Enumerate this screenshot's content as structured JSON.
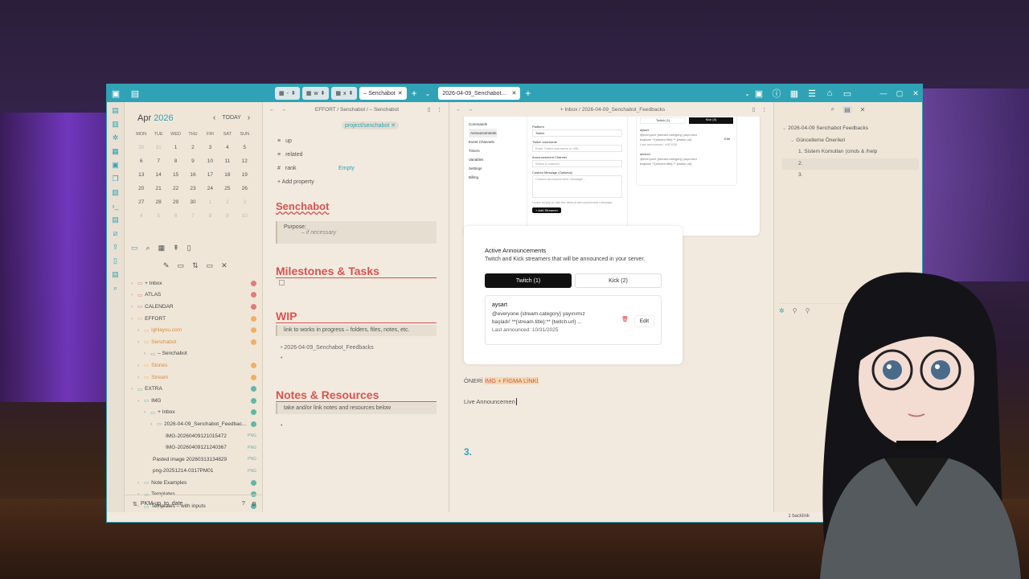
{
  "window": {
    "tabs": [
      {
        "label": "-",
        "pinned": true
      },
      {
        "label": "w",
        "pinned": true
      },
      {
        "label": "x",
        "pinned": true
      },
      {
        "label": "– Senchabot",
        "active": true
      },
      {
        "label": "2026-04-09_Senchabot_Feed...",
        "active": true
      }
    ]
  },
  "calendar": {
    "month": "Apr",
    "year": "2026",
    "today_label": "TODAY",
    "dow": [
      "MON",
      "TUE",
      "WED",
      "THU",
      "FRI",
      "SAT",
      "SUN"
    ],
    "days": [
      [
        "30",
        "31",
        "1",
        "2",
        "3",
        "4",
        "5"
      ],
      [
        "6",
        "7",
        "8",
        "9",
        "10",
        "11",
        "12"
      ],
      [
        "13",
        "14",
        "15",
        "16",
        "17",
        "18",
        "19"
      ],
      [
        "20",
        "21",
        "22",
        "23",
        "24",
        "25",
        "26"
      ],
      [
        "27",
        "28",
        "29",
        "30",
        "1",
        "2",
        "3"
      ],
      [
        "4",
        "5",
        "6",
        "7",
        "8",
        "9",
        "10"
      ]
    ]
  },
  "tree": [
    {
      "label": "+ Inbox",
      "indent": 1,
      "color": "#e07b7b"
    },
    {
      "label": "ATLAS",
      "indent": 1,
      "color": "#e07b7b"
    },
    {
      "label": "CALENDAR",
      "indent": 1,
      "color": "#e07b7b"
    },
    {
      "label": "EFFORT",
      "indent": 1,
      "color": "#f0b060"
    },
    {
      "label": "ighlaysu.com",
      "indent": 2,
      "color": "#f0b060"
    },
    {
      "label": "Senchabot",
      "indent": 2,
      "color": "#f0b060"
    },
    {
      "label": "– Senchabot",
      "indent": 3,
      "color": ""
    },
    {
      "label": "Stories",
      "indent": 2,
      "color": "#f0b060"
    },
    {
      "label": "Stream",
      "indent": 2,
      "color": "#f0b060"
    },
    {
      "label": "EXTRA",
      "indent": 1,
      "color": "#5fb8a8"
    },
    {
      "label": "IMG",
      "indent": 2,
      "color": "#5fb8a8"
    },
    {
      "label": "+ Inbox",
      "indent": 3,
      "color": "#5fb8a8"
    },
    {
      "label": "2026-04-09_Senchabot_Feedbac...",
      "indent": 4,
      "color": "#5fb8a8"
    },
    {
      "label": "IMG-20260409121015472",
      "indent": 5,
      "tag": "PNG"
    },
    {
      "label": "IMG-20260409121240367",
      "indent": 5,
      "tag": "PNG"
    },
    {
      "label": "Pasted image 20260313134829",
      "indent": 3,
      "tag": "PNG"
    },
    {
      "label": "png-20251214-0317PM01",
      "indent": 3,
      "tag": "PNG"
    },
    {
      "label": "Note Examples",
      "indent": 2,
      "color": "#5fb8a8"
    },
    {
      "label": "Templates",
      "indent": 2,
      "color": "#5fb8a8"
    },
    {
      "label": "Templates – with inputs",
      "indent": 2,
      "color": "#5fb8a8"
    }
  ],
  "sidebar_footer": {
    "vault": "PKM-up_to_date"
  },
  "pane1": {
    "breadcrumb": "EFFORT / Senchabot / – Senchabot",
    "tag": "project/senchabot",
    "props": [
      {
        "icon": "≡",
        "key": "up",
        "value": ""
      },
      {
        "icon": "≡",
        "key": "related",
        "value": ""
      },
      {
        "icon": "#",
        "key": "rank",
        "value": "Empty"
      }
    ],
    "add_property": "+ Add property",
    "title": "Senchabot",
    "purpose_label": "Purpose:",
    "purpose_hint": "– if necessary",
    "h_milestones": "Milestones & Tasks",
    "h_wip": "WIP",
    "wip_hint": "link to works in progress – folders, files, notes, etc.",
    "wip_link": "2026-04-09_Senchabot_Feedbacks",
    "h_notes": "Notes & Resources",
    "notes_hint": "take and/or link notes and resources below"
  },
  "pane2": {
    "breadcrumb": "+ Inbox / 2026-04-09_Senchabot_Feedbacks",
    "shot1": {
      "nav": [
        "Commands",
        "Announcements",
        "Event Channels",
        "Timers",
        "Variables",
        "Settings",
        "Billing"
      ],
      "platform_label": "Platform",
      "platform_value": "Twitch",
      "username_label": "Twitch Username",
      "username_placeholder": "Enter Twitch username or URL",
      "channel_label": "Announcement Channel",
      "channel_placeholder": "Select a channel",
      "msg_label": "Custom Message (Optional)",
      "msg_placeholder": "Custom announcement message...",
      "hint": "Leave empty to use the default announcement message",
      "add_btn": "+ Add Streamer",
      "tab_twitch": "Twitch (1)",
      "tab_kick": "Kick (0)",
      "entry1_name": "aysart",
      "entry1_text": "@everyone {stream.category} yayınımız başladı! **{stream.title}:** {twitch.url}",
      "entry1_date": "Last announced: 4/9/2026",
      "entry2_name": "senior1",
      "entry2_text": "@everyone {stream.category} yayınımız başladı! **{stream.title}:** {twitch.url}",
      "edit_label": "Edit"
    },
    "card": {
      "title": "Active Announcements",
      "subtitle": "Twitch and Kick streamers that will be announced in your server.",
      "tab_twitch": "Twitch (1)",
      "tab_kick": "Kick (2)",
      "name": "aysart",
      "line1": "@everyone {stream.category} yayınımız",
      "line2": "başladı! **{stream.title}:** {twitch.url} ...",
      "date": "Last announced: 10/31/2025",
      "edit": "Edit"
    },
    "oneri_prefix": "ÖNERİ",
    "oneri_highlight": "IMG + FİGMA LİNKİ",
    "live": "Live Announcemen",
    "h3": "3."
  },
  "pane3": {
    "outline": [
      {
        "text": "2026-04-09 Senchabot Feedbacks",
        "indent": 0
      },
      {
        "text": "Güncelleme Önerileri",
        "indent": 1
      },
      {
        "text": "1. Sistem Komutları (cmds & /help",
        "indent": 2
      },
      {
        "text": "2.",
        "indent": 2
      },
      {
        "text": "3.",
        "indent": 2
      }
    ]
  },
  "status": {
    "backlinks": "1 backlink"
  },
  "colors": {
    "accent": "#2fa3b5",
    "heading": "#d9534f"
  }
}
